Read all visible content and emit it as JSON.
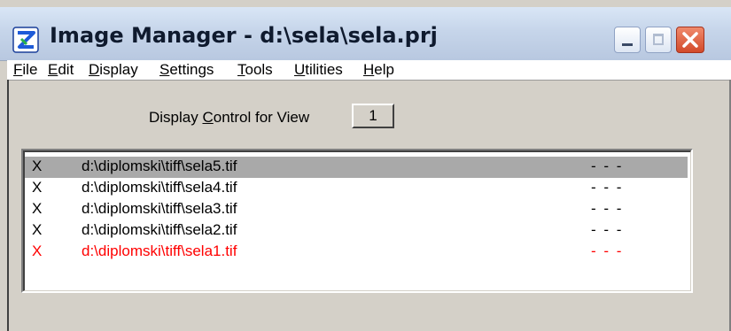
{
  "window": {
    "title": "Image Manager - d:\\sela\\sela.prj",
    "controls": {
      "minimize": "minimize-icon",
      "maximize": "maximize-icon",
      "close": "close-icon"
    }
  },
  "menu": {
    "items": [
      {
        "mnemonic": "F",
        "rest": "ile"
      },
      {
        "mnemonic": "E",
        "rest": "dit"
      },
      {
        "mnemonic": "D",
        "rest": "isplay"
      },
      {
        "mnemonic": "S",
        "rest": "ettings"
      },
      {
        "mnemonic": "T",
        "rest": "ools"
      },
      {
        "mnemonic": "U",
        "rest": "tilities"
      },
      {
        "mnemonic": "H",
        "rest": "elp"
      }
    ]
  },
  "display_control": {
    "label_before": "Display ",
    "label_mnemonic": "C",
    "label_after": "ontrol for View",
    "view_number": "1"
  },
  "images": [
    {
      "mark": "X",
      "path": "d:\\diplomski\\tiff\\sela5.tif",
      "status": "- - -",
      "selected": true,
      "color": "#000000"
    },
    {
      "mark": "X",
      "path": "d:\\diplomski\\tiff\\sela4.tif",
      "status": "- - -",
      "selected": false,
      "color": "#000000"
    },
    {
      "mark": "X",
      "path": "d:\\diplomski\\tiff\\sela3.tif",
      "status": "- - -",
      "selected": false,
      "color": "#000000"
    },
    {
      "mark": "X",
      "path": "d:\\diplomski\\tiff\\sela2.tif",
      "status": "- - -",
      "selected": false,
      "color": "#000000"
    },
    {
      "mark": "X",
      "path": "d:\\diplomski\\tiff\\sela1.tif",
      "status": "- - -",
      "selected": false,
      "color": "#ff0000"
    }
  ],
  "colors": {
    "selection": "#a9a9a9",
    "highlight_row_text": "#ff0000",
    "title_bar": "#c6d5ea"
  }
}
